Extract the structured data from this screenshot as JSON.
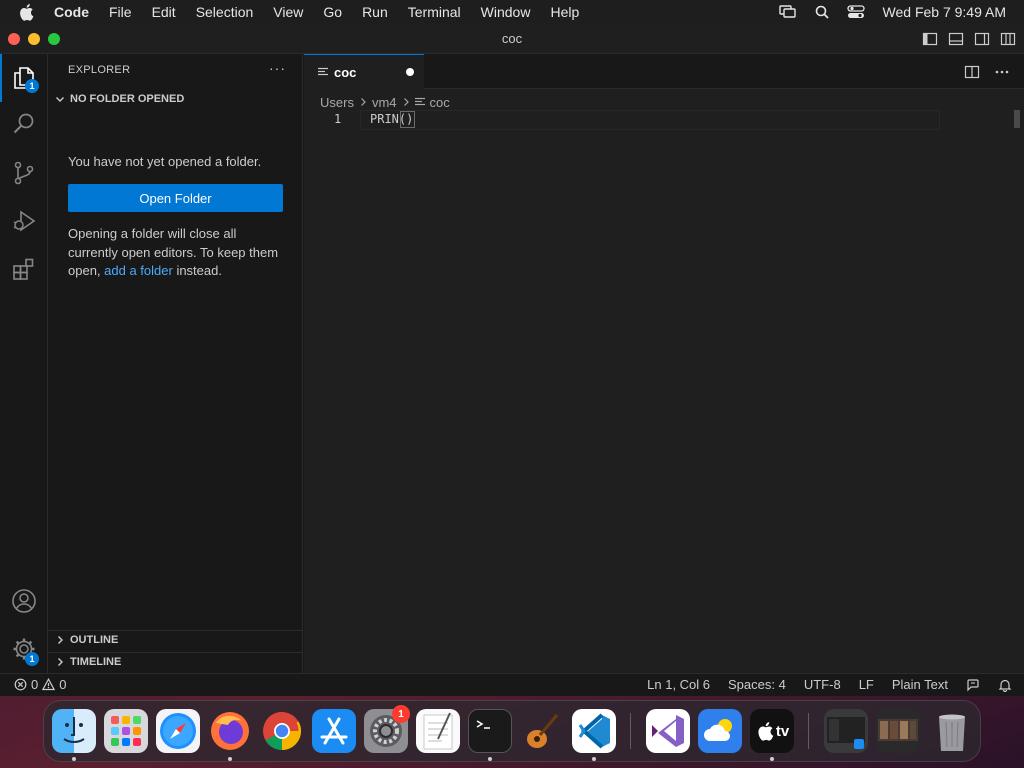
{
  "menubar": {
    "app_name": "Code",
    "items": [
      "File",
      "Edit",
      "Selection",
      "View",
      "Go",
      "Run",
      "Terminal",
      "Window",
      "Help"
    ],
    "clock": "Wed Feb 7  9:49 AM"
  },
  "window": {
    "title": "coc"
  },
  "activity_bar": {
    "explorer_badge": "1",
    "settings_badge": "1"
  },
  "sidebar": {
    "header": "EXPLORER",
    "more_label": "···",
    "section": "NO FOLDER OPENED",
    "message": "You have not yet opened a folder.",
    "open_folder_label": "Open Folder",
    "info_prefix": "Opening a folder will close all currently open editors. To keep them open, ",
    "info_link": "add a folder",
    "info_suffix": " instead.",
    "outline": "OUTLINE",
    "timeline": "TIMELINE"
  },
  "editor": {
    "tab_label": "coc",
    "breadcrumb": [
      "Users",
      "vm4",
      "coc"
    ],
    "line_number": "1",
    "code_text": "PRIN()"
  },
  "statusbar": {
    "errors": "0",
    "warnings": "0",
    "position": "Ln 1, Col 6",
    "spaces": "Spaces: 4",
    "encoding": "UTF-8",
    "eol": "LF",
    "language": "Plain Text"
  },
  "dock": {
    "settings_badge": "1",
    "tv_label": "tv"
  },
  "colors": {
    "accent": "#0078d4",
    "link": "#4daafc",
    "close": "#ff5f57",
    "minimize": "#febc2e",
    "zoom": "#28c840"
  }
}
